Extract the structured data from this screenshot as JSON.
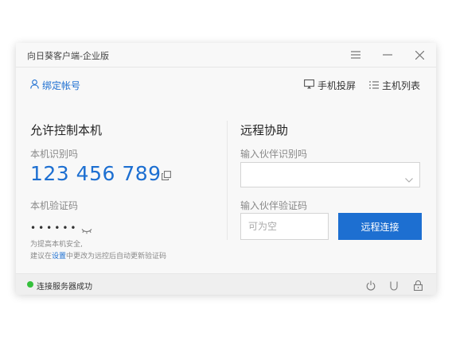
{
  "window": {
    "title": "向日葵客户端-企业版",
    "controls": {
      "menu_icon": "menu-icon",
      "minimize_icon": "minimize-icon",
      "close_icon": "close-icon"
    }
  },
  "toolbar": {
    "bind_account": "绑定帐号",
    "phone_cast": "手机投屏",
    "host_list": "主机列表"
  },
  "left_panel": {
    "title": "允许控制本机",
    "device_id_label": "本机识别吗",
    "device_id": "123 456 789",
    "verify_code_label": "本机验证码",
    "verify_code_masked": "••••••",
    "hint_line1": "为提高本机安全,",
    "hint_line2_prefix": "建议在",
    "hint_link": "设置",
    "hint_line2_suffix": "中更改为远控后自动更新验证码"
  },
  "right_panel": {
    "title": "远程协助",
    "partner_id_label": "输入伙伴识别吗",
    "partner_id_value": "",
    "partner_code_label": "输入伙伴验证码",
    "partner_code_placeholder": "可为空",
    "connect_button": "远程连接"
  },
  "statusbar": {
    "status_text": "连接服务器成功",
    "status_color": "#35c03c"
  },
  "colors": {
    "accent": "#1d6fd1"
  }
}
